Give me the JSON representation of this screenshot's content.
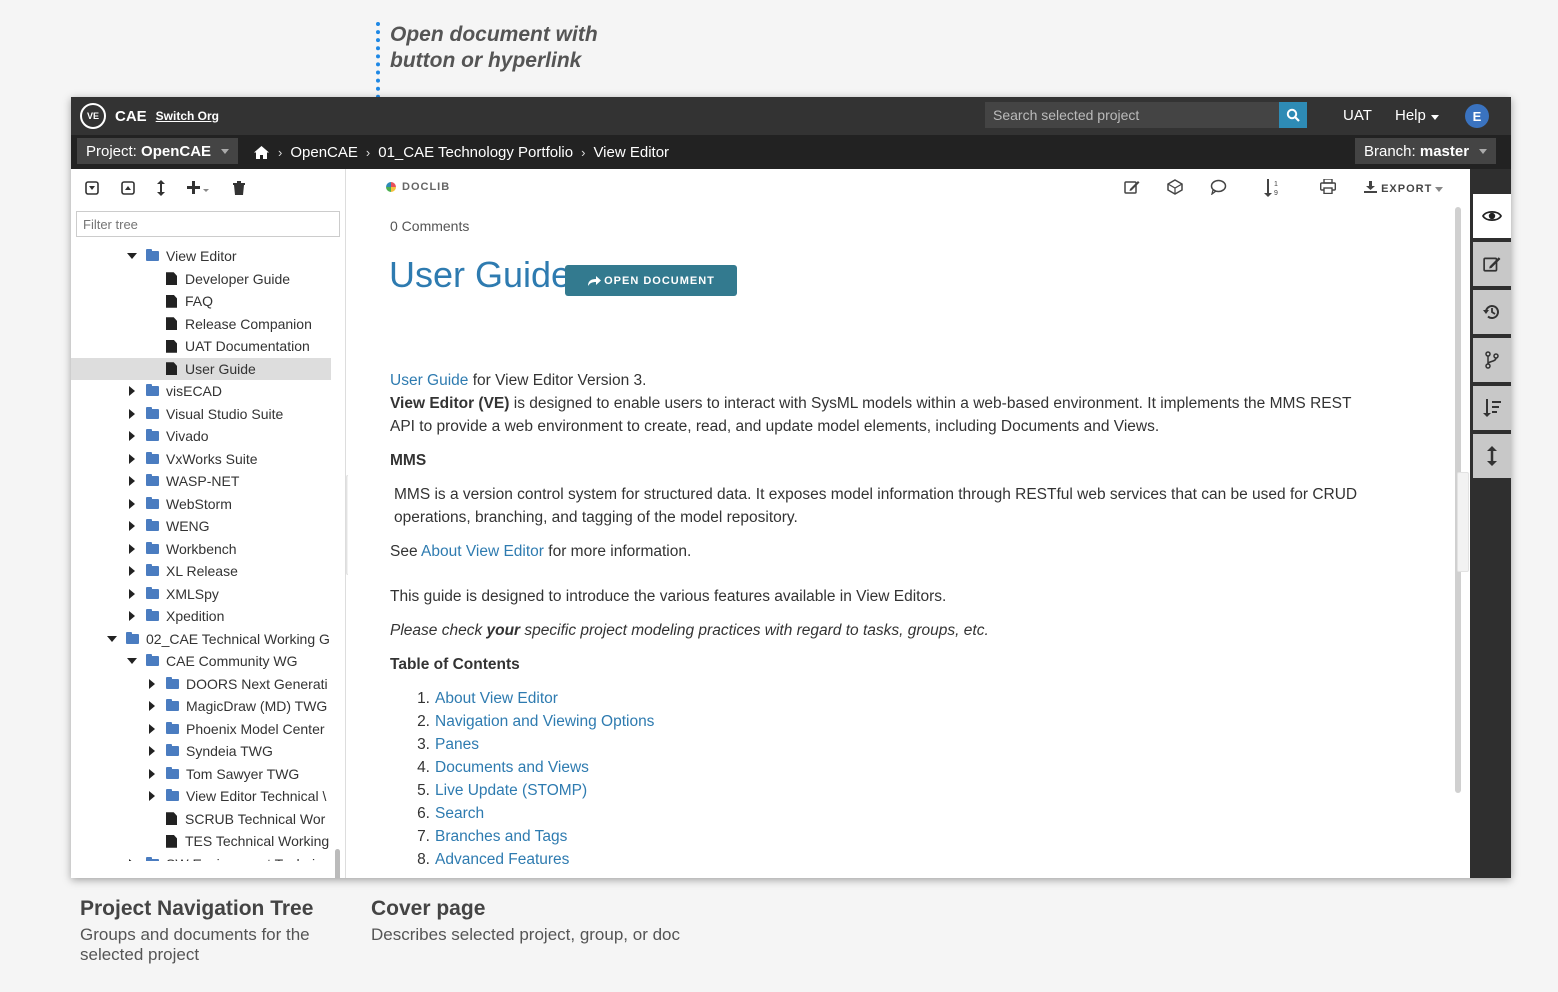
{
  "annotations": {
    "top": [
      "Open document with",
      "button or hyperlink"
    ],
    "nav_title": "Project Navigation Tree",
    "nav_desc": "Groups and documents for the selected project",
    "cover_title": "Cover page",
    "cover_desc": "Describes selected project, group, or doc"
  },
  "topbar": {
    "logo": "VE",
    "org": "CAE",
    "switch_org": "Switch Org",
    "search_placeholder": "Search selected project",
    "uat": "UAT",
    "help": "Help",
    "avatar": "E"
  },
  "navbar": {
    "project_label": "Project: ",
    "project_name": "OpenCAE",
    "crumbs": [
      "OpenCAE",
      "01_CAE Technology Portfolio",
      "View Editor"
    ],
    "branch_label": "Branch: ",
    "branch_name": "master"
  },
  "tree": {
    "filter_placeholder": "Filter tree",
    "nodes": [
      {
        "label": "View Editor",
        "indent": 55,
        "type": "folder",
        "tw": "down"
      },
      {
        "label": "Developer Guide",
        "indent": 75,
        "type": "doc",
        "tw": "none"
      },
      {
        "label": "FAQ",
        "indent": 75,
        "type": "doc",
        "tw": "none"
      },
      {
        "label": "Release Companion",
        "indent": 75,
        "type": "doc",
        "tw": "none"
      },
      {
        "label": "UAT Documentation",
        "indent": 75,
        "type": "doc",
        "tw": "none"
      },
      {
        "label": "User Guide",
        "indent": 75,
        "type": "doc",
        "tw": "none",
        "selected": true
      },
      {
        "label": "visECAD",
        "indent": 55,
        "type": "folder",
        "tw": "right"
      },
      {
        "label": "Visual Studio Suite",
        "indent": 55,
        "type": "folder",
        "tw": "right"
      },
      {
        "label": "Vivado",
        "indent": 55,
        "type": "folder",
        "tw": "right"
      },
      {
        "label": "VxWorks Suite",
        "indent": 55,
        "type": "folder",
        "tw": "right"
      },
      {
        "label": "WASP-NET",
        "indent": 55,
        "type": "folder",
        "tw": "right"
      },
      {
        "label": "WebStorm",
        "indent": 55,
        "type": "folder",
        "tw": "right"
      },
      {
        "label": "WENG",
        "indent": 55,
        "type": "folder",
        "tw": "right"
      },
      {
        "label": "Workbench",
        "indent": 55,
        "type": "folder",
        "tw": "right"
      },
      {
        "label": "XL Release",
        "indent": 55,
        "type": "folder",
        "tw": "right"
      },
      {
        "label": "XMLSpy",
        "indent": 55,
        "type": "folder",
        "tw": "right"
      },
      {
        "label": "Xpedition",
        "indent": 55,
        "type": "folder",
        "tw": "right"
      },
      {
        "label": "02_CAE Technical Working G",
        "indent": 35,
        "type": "folder",
        "tw": "down"
      },
      {
        "label": "CAE Community WG",
        "indent": 55,
        "type": "folder",
        "tw": "down"
      },
      {
        "label": "DOORS Next Generati",
        "indent": 75,
        "type": "folder",
        "tw": "right"
      },
      {
        "label": "MagicDraw (MD) TWG",
        "indent": 75,
        "type": "folder",
        "tw": "right"
      },
      {
        "label": "Phoenix Model Center",
        "indent": 75,
        "type": "folder",
        "tw": "right"
      },
      {
        "label": "Syndeia TWG",
        "indent": 75,
        "type": "folder",
        "tw": "right"
      },
      {
        "label": "Tom Sawyer TWG",
        "indent": 75,
        "type": "folder",
        "tw": "right"
      },
      {
        "label": "View Editor Technical \\",
        "indent": 75,
        "type": "folder",
        "tw": "right"
      },
      {
        "label": "SCRUB Technical Wor",
        "indent": 75,
        "type": "doc",
        "tw": "none"
      },
      {
        "label": "TES Technical Working",
        "indent": 75,
        "type": "doc",
        "tw": "none"
      },
      {
        "label": "SW Environment Technica",
        "indent": 55,
        "type": "folder",
        "tw": "right"
      }
    ]
  },
  "main": {
    "doclib": "DOCLIB",
    "export": "EXPORT",
    "comments": "0 Comments",
    "title": "User Guide",
    "open_button": "OPEN DOCUMENT",
    "intro_link": "User Guide",
    "intro_rest": " for View Editor Version 3.",
    "ve_bold": "View Editor (VE)",
    "ve_text": " is designed to enable users to interact with SysML models within a web-based environment. It implements the MMS REST API to provide a web environment to create, read, and update model elements, including Documents and Views.",
    "mms_heading": "MMS",
    "mms_text": "MMS is a version control system for structured data. It exposes model information through RESTful web services that can be used for CRUD operations, branching, and tagging of the model repository.",
    "see_pre": "See ",
    "see_link": "About View Editor",
    "see_post": " for more information.",
    "guide_text": "This guide is designed to introduce the various features available in View Editors.",
    "check_pre": "Please check ",
    "check_bold": "your",
    "check_post": " specific project modeling practices with regard to tasks, groups, etc.",
    "toc_heading": "Table of Contents",
    "toc": [
      {
        "n": "1.",
        "label": "About View Editor"
      },
      {
        "n": "2.",
        "label": "Navigation and Viewing Options"
      },
      {
        "n": "3.",
        "label": "Panes"
      },
      {
        "n": "4.",
        "label": "Documents and Views"
      },
      {
        "n": "5.",
        "label": "Live Update (STOMP)"
      },
      {
        "n": "6.",
        "label": "Search"
      },
      {
        "n": "7.",
        "label": "Branches and Tags"
      },
      {
        "n": "8.",
        "label": "Advanced Features"
      }
    ]
  },
  "colors": {
    "accent": "#2e7bb0",
    "open_button": "#337a8f",
    "topbar": "#333333",
    "navbar": "#222222"
  }
}
